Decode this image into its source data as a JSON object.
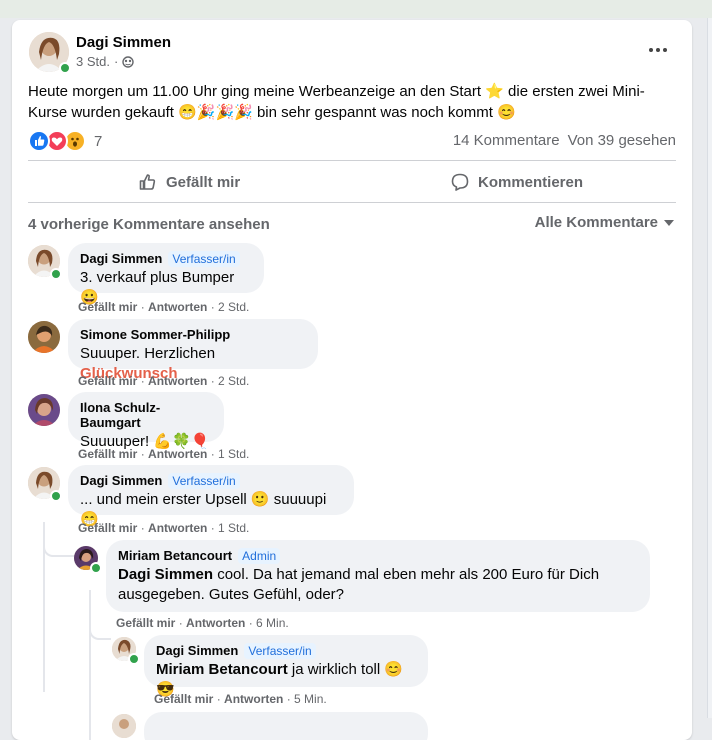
{
  "post": {
    "author": "Dagi Simmen",
    "time": "3 Std.",
    "text_line1": "Heute morgen um 11.00 Uhr ging meine Werbeanzeige an den Start ⭐ die ersten zwei Mini-",
    "text_line2": "Kurse wurden gekauft 😁🎉🎉🎉 bin sehr gespannt was noch kommt 😊",
    "reaction_count": "7",
    "comment_count": "14 Kommentare",
    "seen_count": "Von 39 gesehen"
  },
  "actions": {
    "like": "Gefällt mir",
    "comment": "Kommentieren"
  },
  "comments_header": {
    "previous": "4 vorherige Kommentare ansehen",
    "filter": "Alle Kommentare"
  },
  "comments": [
    {
      "name": "Dagi Simmen",
      "badge": "Verfasser/in",
      "text": "3. verkauf plus Bumper 😀",
      "like": "Gefällt mir",
      "reply": "Antworten",
      "time": "2 Std."
    },
    {
      "name": "Simone Sommer-Philipp",
      "text": "Suuuper. Herzlichen ",
      "highlight": "Glückwunsch",
      "like": "Gefällt mir",
      "reply": "Antworten",
      "time": "2 Std."
    },
    {
      "name": "Ilona Schulz-Baumgart",
      "text": "Suuuuper! 💪🍀🎈",
      "like": "Gefällt mir",
      "reply": "Antworten",
      "time": "1 Std."
    },
    {
      "name": "Dagi Simmen",
      "badge": "Verfasser/in",
      "text": "... und mein erster Upsell 🙂 suuuupi 😁",
      "like": "Gefällt mir",
      "reply": "Antworten",
      "time": "1 Std."
    }
  ],
  "replies": [
    {
      "name": "Miriam Betancourt",
      "badge": "Admin",
      "mention": "Dagi Simmen",
      "text_line1": " cool. Da hat jemand mal eben mehr als 200 Euro für Dich",
      "text_line2": "ausgegeben. Gutes Gefühl, oder?",
      "like": "Gefällt mir",
      "reply": "Antworten",
      "time": "6 Min."
    },
    {
      "name": "Dagi Simmen",
      "badge": "Verfasser/in",
      "mention": "Miriam Betancourt",
      "text": " ja wirklich toll 😊😎",
      "like": "Gefällt mir",
      "reply": "Antworten",
      "time": "5 Min."
    }
  ],
  "colors": {
    "accent_blue": "#216fdb",
    "highlight_red": "#e4604a",
    "online_green": "#31a24c",
    "bubble_grey": "#f0f2f5"
  }
}
